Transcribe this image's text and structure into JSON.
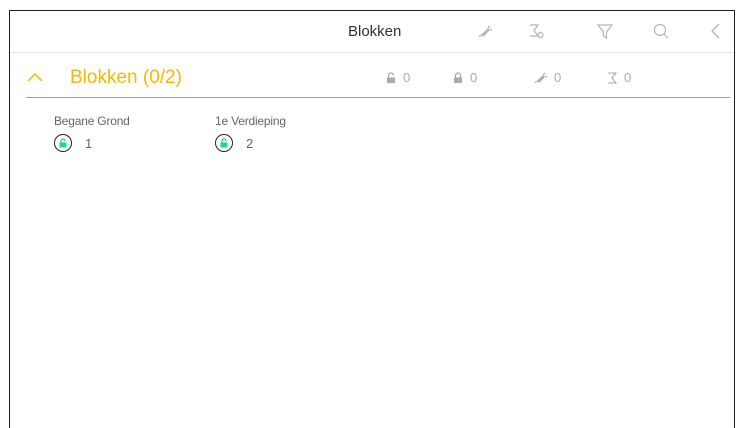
{
  "header": {
    "title": "Blokken",
    "icons": [
      "alarm-bell-icon",
      "filter-sigma-icon",
      "filter-icon",
      "search-icon",
      "back-chevron-icon"
    ]
  },
  "section": {
    "title": "Blokken (0/2)",
    "stats": [
      {
        "icon": "unlocked-icon",
        "value": "0"
      },
      {
        "icon": "locked-icon",
        "value": "0"
      },
      {
        "icon": "alarm-bell-icon",
        "value": "0"
      },
      {
        "icon": "timer-icon",
        "value": "0"
      }
    ]
  },
  "blocks": [
    {
      "name": "Begane Grond",
      "number": "1",
      "status": "unlocked"
    },
    {
      "name": "1e Verdieping",
      "number": "2",
      "status": "unlocked"
    }
  ],
  "colors": {
    "accent": "#f5b800",
    "lock_green": "#1fd39a",
    "icon_gray": "#b5b5b5",
    "divider": "#9e9e9e"
  }
}
